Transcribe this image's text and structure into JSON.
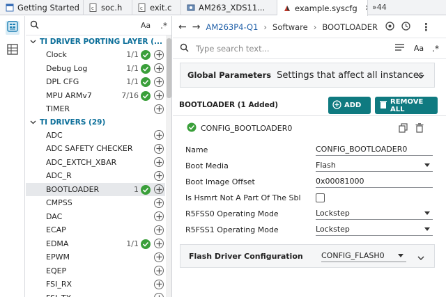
{
  "tabs": [
    {
      "label": "Getting Started",
      "active": false,
      "closable": false,
      "icon": "page-icon"
    },
    {
      "label": "soc.h",
      "active": false,
      "closable": false,
      "icon": "c-header-file-icon"
    },
    {
      "label": "exit.c",
      "active": false,
      "closable": false,
      "icon": "c-file-icon"
    },
    {
      "label": "AM263_XDS11...",
      "active": false,
      "closable": false,
      "icon": "debug-icon"
    },
    {
      "label": "example.syscfg",
      "active": true,
      "closable": true,
      "icon": "syscfg-icon"
    }
  ],
  "tab_overflow": "»44",
  "left_panel": {
    "search_case_label": "Aa",
    "groups": [
      {
        "label": "TI DRIVER PORTING LAYER (...",
        "items": [
          {
            "label": "Clock",
            "count": "1/1",
            "added": true
          },
          {
            "label": "Debug Log",
            "count": "1/1",
            "added": true
          },
          {
            "label": "DPL CFG",
            "count": "1/1",
            "added": true
          },
          {
            "label": "MPU ARMv7",
            "count": "7/16",
            "added": true
          },
          {
            "label": "TIMER",
            "count": "",
            "added": false
          }
        ]
      },
      {
        "label": "TI DRIVERS (29)",
        "items": [
          {
            "label": "ADC",
            "count": "",
            "added": false
          },
          {
            "label": "ADC SAFETY CHECKER",
            "count": "",
            "added": false
          },
          {
            "label": "ADC_EXTCH_XBAR",
            "count": "",
            "added": false
          },
          {
            "label": "ADC_R",
            "count": "",
            "added": false
          },
          {
            "label": "BOOTLOADER",
            "count": "1",
            "added": true,
            "selected": true
          },
          {
            "label": "CMPSS",
            "count": "",
            "added": false
          },
          {
            "label": "DAC",
            "count": "",
            "added": false
          },
          {
            "label": "ECAP",
            "count": "",
            "added": false
          },
          {
            "label": "EDMA",
            "count": "1/1",
            "added": true
          },
          {
            "label": "EPWM",
            "count": "",
            "added": false
          },
          {
            "label": "EQEP",
            "count": "",
            "added": false
          },
          {
            "label": "FSI_RX",
            "count": "",
            "added": false
          },
          {
            "label": "FSI_TX",
            "count": "",
            "added": false
          }
        ]
      }
    ]
  },
  "nav": {
    "device": "AM263P4-Q1",
    "crumb_software": "Software",
    "crumb_module": "BOOTLOADER"
  },
  "search": {
    "placeholder": "Type search text...",
    "case_label": "Aa"
  },
  "global_parameters": {
    "title": "Global Parameters",
    "description": "Settings that affect all instances"
  },
  "module": {
    "header": "BOOTLOADER (1 Added)",
    "add_label": "ADD",
    "remove_all_label": "REMOVE ALL",
    "instance_name": "CONFIG_BOOTLOADER0",
    "fields": [
      {
        "label": "Name",
        "value": "CONFIG_BOOTLOADER0",
        "kind": "text"
      },
      {
        "label": "Boot Media",
        "value": "Flash",
        "kind": "select"
      },
      {
        "label": "Boot Image Offset",
        "value": "0x00081000",
        "kind": "text"
      },
      {
        "label": "Is Hsmrt Not A Part Of The Sbl",
        "value": "",
        "kind": "checkbox",
        "checked": false
      },
      {
        "label": "R5FSS0 Operating Mode",
        "value": "Lockstep",
        "kind": "select"
      },
      {
        "label": "R5FSS1 Operating Mode",
        "value": "Lockstep",
        "kind": "select"
      }
    ],
    "flash_config": {
      "title": "Flash Driver Configuration",
      "value": "CONFIG_FLASH0"
    }
  },
  "colors": {
    "accent": "#0f7a80",
    "check": "#3a9f3a",
    "link": "#1f5fa8",
    "group": "#0b6e99"
  }
}
